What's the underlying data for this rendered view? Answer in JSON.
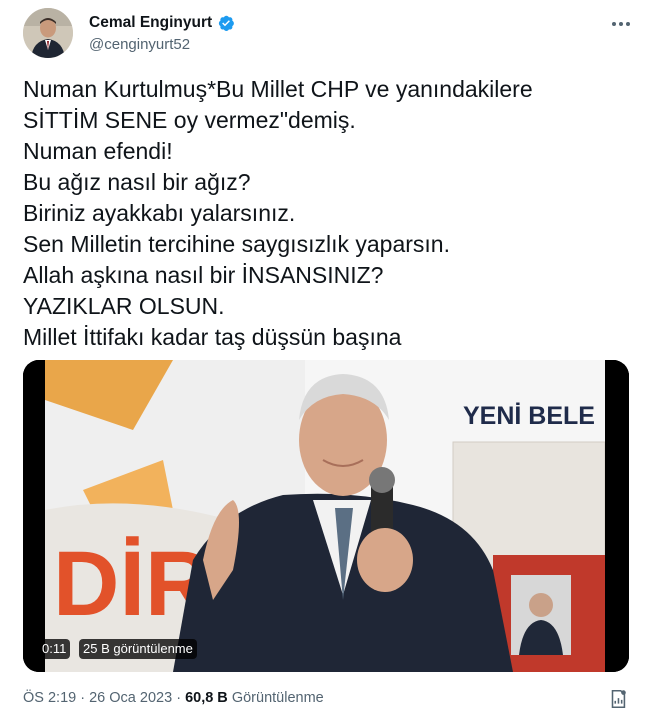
{
  "author": {
    "display_name": "Cemal Enginyurt",
    "handle": "@cenginyurt52",
    "avatar_icon": "profile-photo",
    "verified_icon": "verified-badge-icon",
    "verified_color": "#1d9bf0"
  },
  "tweet": {
    "text": "Numan Kurtulmuş*Bu Millet CHP ve yanındakilere\nSİTTİM SENE oy vermez\"demiş.\nNuman efendi!\nBu ağız nasıl bir ağız?\nBiriniz ayakkabı yalarsınız.\nSen Milletin tercihine saygısızlık yaparsın.\nAllah aşkına nasıl bir İNSANSINIZ?\nYAZIKLAR OLSUN.\nMillet İttifakı kadar taş düşsün başına"
  },
  "media": {
    "type": "video",
    "duration": "0:11",
    "views_label": "25 B görüntülenme",
    "scene_sign_text": "YENİ BELE",
    "scene_backdrop_text": "DİR"
  },
  "meta": {
    "time": "ÖS 2:19",
    "separator": "·",
    "date": "26 Oca 2023",
    "view_count": "60,8 B",
    "views_word": "Görüntülenme"
  },
  "colors": {
    "text_primary": "#0f1419",
    "text_secondary": "#536471",
    "accent": "#1d9bf0"
  }
}
